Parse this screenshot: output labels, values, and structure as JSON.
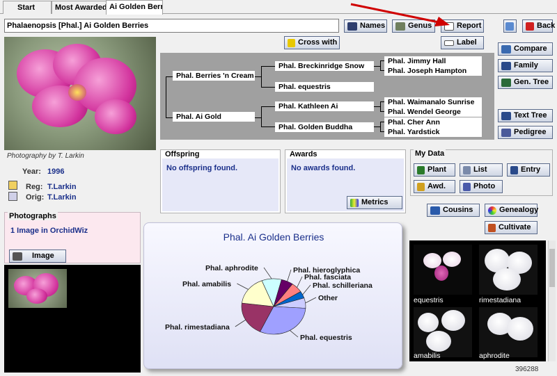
{
  "tabs": [
    {
      "label": "Start"
    },
    {
      "label": "Most Awarded"
    },
    {
      "label": "Ai Golden Berries"
    }
  ],
  "search": {
    "value": "Phalaenopsis [Phal.] Ai Golden Berries"
  },
  "toolbar": {
    "names": "Names",
    "genus": "Genus",
    "report": "Report",
    "back": "Back",
    "cross_with": "Cross with",
    "label": "Label"
  },
  "side_buttons": {
    "compare": "Compare",
    "family": "Family",
    "gen_tree": "Gen. Tree",
    "text_tree": "Text Tree",
    "pedigree": "Pedigree"
  },
  "photo": {
    "caption": "Photography by T. Larkin"
  },
  "details": {
    "year_label": "Year:",
    "year": "1996",
    "reg_label": "Reg:",
    "reg": "T.Larkin",
    "orig_label": "Orig:",
    "orig": "T.Larkin"
  },
  "tree": {
    "parents": [
      "Phal. Berries 'n Cream",
      "Phal. Ai Gold"
    ],
    "grandparents": [
      "Phal. Breckinridge Snow",
      "Phal. equestris",
      "Phal. Kathleen Ai",
      "Phal. Golden Buddha"
    ],
    "great_grandparents": [
      "Phal. Jimmy Hall",
      "Phal. Joseph Hampton",
      "Phal. Waimanalo Sunrise",
      "Phal. Wendel George",
      "Phal. Cher Ann",
      "Phal. Yardstick"
    ]
  },
  "offspring": {
    "title": "Offspring",
    "text": "No offspring found."
  },
  "awards": {
    "title": "Awards",
    "text": "No awards found.",
    "metrics": "Metrics"
  },
  "mydata": {
    "title": "My Data",
    "plant": "Plant",
    "list": "List",
    "entry": "Entry",
    "awd": "Awd.",
    "photo": "Photo"
  },
  "extra_buttons": {
    "cousins": "Cousins",
    "genealogy": "Genealogy",
    "cultivate": "Cultivate"
  },
  "photographs": {
    "title": "Photographs",
    "count_text": "1 Image in OrchidWiz",
    "image_button": "Image"
  },
  "gallery": {
    "labels": [
      "equestris",
      "rimestadiana",
      "amabilis",
      "aphrodite"
    ]
  },
  "footer": {
    "id": "396288"
  },
  "chart_data": {
    "type": "pie",
    "title": "Phal. Ai Golden Berries",
    "slices": [
      {
        "label": "Phal. equestris",
        "value": 31,
        "color": "#9fa0ff"
      },
      {
        "label": "Phal. rimestadiana",
        "value": 20,
        "color": "#993366"
      },
      {
        "label": "Phal. amabilis",
        "value": 17,
        "color": "#ffffcc"
      },
      {
        "label": "Phal. aphrodite",
        "value": 10,
        "color": "#ccffff"
      },
      {
        "label": "Phal. hieroglyphica",
        "value": 6,
        "color": "#660066"
      },
      {
        "label": "Phal. fasciata",
        "value": 6,
        "color": "#ff8080"
      },
      {
        "label": "Phal. schilleriana",
        "value": 4,
        "color": "#0066cc"
      },
      {
        "label": "Other",
        "value": 6,
        "color": "#ccccff"
      }
    ]
  }
}
